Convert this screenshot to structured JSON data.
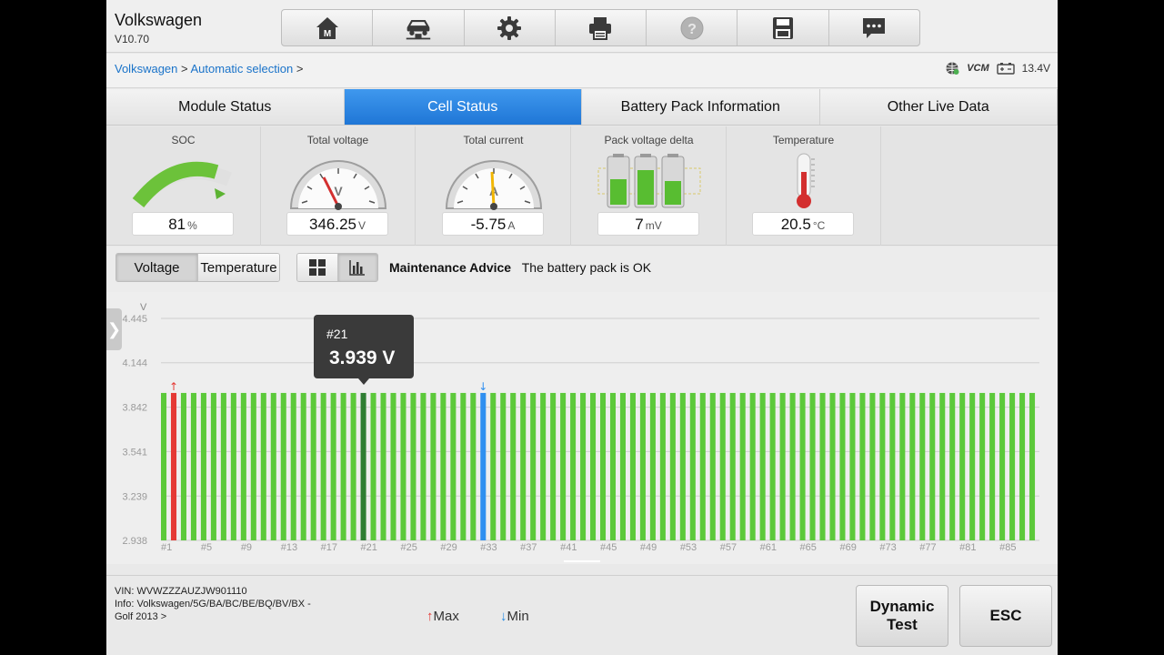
{
  "app": {
    "name": "Volkswagen",
    "version": "V10.70"
  },
  "breadcrumb": {
    "items": [
      "Volkswagen",
      "Automatic selection"
    ],
    "sep": ">"
  },
  "status": {
    "vcm_label": "VCM",
    "battery_voltage": "13.4V"
  },
  "toolbar": {
    "icons": [
      "home-icon",
      "vehicle-lift-icon",
      "gear-icon",
      "printer-icon",
      "help-icon",
      "save-icon",
      "message-icon"
    ]
  },
  "tabs": [
    {
      "label": "Module Status",
      "active": false
    },
    {
      "label": "Cell Status",
      "active": true
    },
    {
      "label": "Battery Pack Information",
      "active": false
    },
    {
      "label": "Other Live Data",
      "active": false
    }
  ],
  "gauges": {
    "soc": {
      "title": "SOC",
      "value": "81",
      "unit": "%",
      "level": 0.81
    },
    "voltage": {
      "title": "Total voltage",
      "value": "346.25",
      "unit": "V",
      "dial_letter": "V"
    },
    "current": {
      "title": "Total current",
      "value": "-5.75",
      "unit": "A",
      "dial_letter": "A"
    },
    "delta": {
      "title": "Pack voltage delta",
      "value": "7",
      "unit": "mV"
    },
    "temperature": {
      "title": "Temperature",
      "value": "20.5",
      "unit": "°C"
    }
  },
  "controls": {
    "voltage_label": "Voltage",
    "temperature_label": "Temperature",
    "advice_label": "Maintenance Advice",
    "advice_text": "The battery pack is OK"
  },
  "chart_data": {
    "type": "bar",
    "ylabel": "V",
    "y_ticks": [
      "2.938",
      "3.239",
      "3.541",
      "3.842",
      "4.144",
      "4.445"
    ],
    "ylim": [
      2.938,
      4.445
    ],
    "x_tick_labels": [
      "#1",
      "#5",
      "#9",
      "#13",
      "#17",
      "#21",
      "#25",
      "#29",
      "#33",
      "#37",
      "#41",
      "#45",
      "#49",
      "#53",
      "#57",
      "#61",
      "#65",
      "#69",
      "#73",
      "#77",
      "#81",
      "#85"
    ],
    "cell_count": 88,
    "typical_value": 3.939,
    "max_cell": 2,
    "min_cell": 33,
    "selected_cell": 21,
    "colors": {
      "normal": "#5cc93a",
      "max": "#e53935",
      "min": "#2f8ff0",
      "selected": "#2e7d32"
    },
    "tooltip": {
      "cell": "#21",
      "value": "3.939 V"
    }
  },
  "footer": {
    "vin": "VIN: WVWZZZAUZJW901110",
    "info_line1": "Info: Volkswagen/5G/BA/BC/BE/BQ/BV/BX -",
    "info_line2": "Golf 2013 >",
    "max_label": "Max",
    "min_label": "Min",
    "dynamic_test_line1": "Dynamic",
    "dynamic_test_line2": "Test",
    "esc_label": "ESC"
  }
}
